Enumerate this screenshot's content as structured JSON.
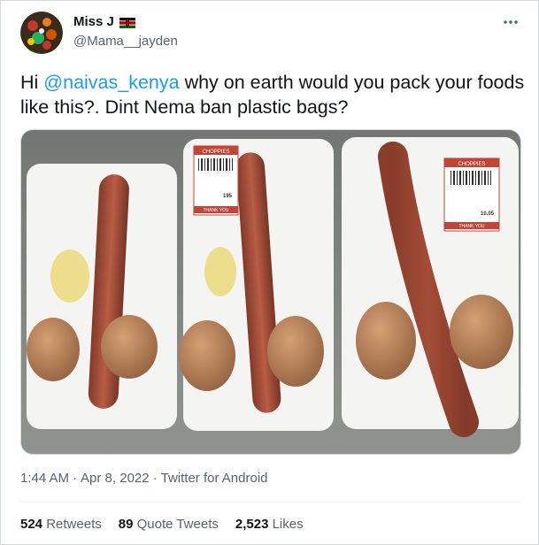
{
  "author": {
    "display_name": "Miss J",
    "handle": "@Mama__jayden"
  },
  "tweet": {
    "mention": "@naivas_kenya",
    "text_before": "Hi ",
    "text_after": " why on earth would you pack your foods like this?. Dint Nema ban plastic bags?"
  },
  "media": {
    "label_brand": "CHOPPIES",
    "label_thanks": "THANK YOU",
    "prices": [
      "195",
      "10.05"
    ]
  },
  "meta": {
    "time": "1:44 AM",
    "date": "Apr 8, 2022",
    "source": "Twitter for Android"
  },
  "stats": {
    "retweets_count": "524",
    "retweets_label": "Retweets",
    "quotes_count": "89",
    "quotes_label": "Quote Tweets",
    "likes_count": "2,523",
    "likes_label": "Likes"
  },
  "colors": {
    "accent": "#1d9bf0",
    "secondary_text": "#536471",
    "border": "#cfd9de"
  }
}
